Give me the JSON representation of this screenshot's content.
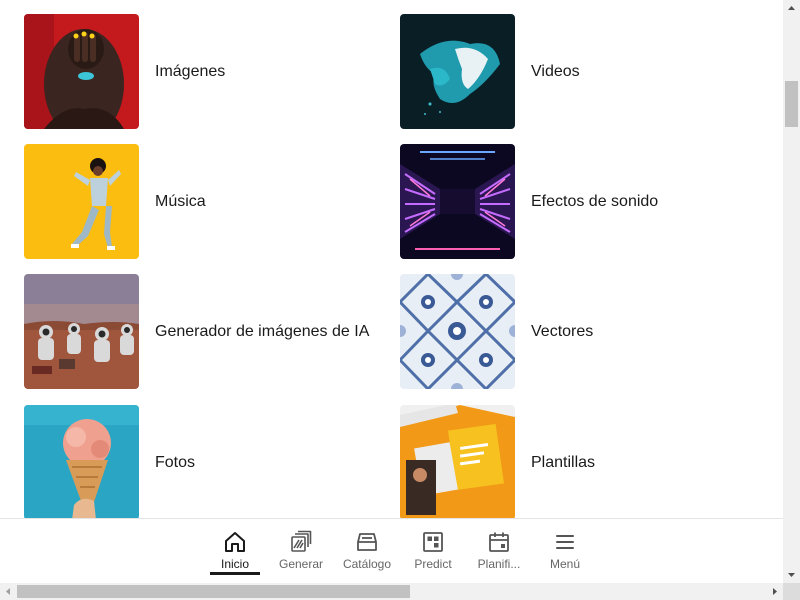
{
  "categories": [
    {
      "label": "Imágenes",
      "icon": "woman-portrait-thumbnail"
    },
    {
      "label": "Videos",
      "icon": "teal-fabric-thumbnail"
    },
    {
      "label": "Música",
      "icon": "dancer-yellow-thumbnail"
    },
    {
      "label": "Efectos de sonido",
      "icon": "neon-tunnel-thumbnail"
    },
    {
      "label": "Generador de imágenes de IA",
      "icon": "astronauts-desert-thumbnail"
    },
    {
      "label": "Vectores",
      "icon": "blue-pattern-thumbnail"
    },
    {
      "label": "Fotos",
      "icon": "ice-cream-thumbnail"
    },
    {
      "label": "Plantillas",
      "icon": "template-orange-thumbnail"
    }
  ],
  "bottom_nav": [
    {
      "label": "Inicio",
      "icon": "home-icon",
      "active": true
    },
    {
      "label": "Generar",
      "icon": "generate-icon",
      "active": false
    },
    {
      "label": "Catálogo",
      "icon": "catalog-icon",
      "active": false
    },
    {
      "label": "Predict",
      "icon": "predict-icon",
      "active": false
    },
    {
      "label": "Planifi...",
      "icon": "calendar-icon",
      "active": false
    },
    {
      "label": "Menú",
      "icon": "menu-icon",
      "active": false
    }
  ],
  "colors": {
    "text": "#1a1a1a",
    "nav_inactive": "#666666",
    "scrollbar_track": "#f1f1f1",
    "scrollbar_thumb": "#c1c1c1"
  }
}
